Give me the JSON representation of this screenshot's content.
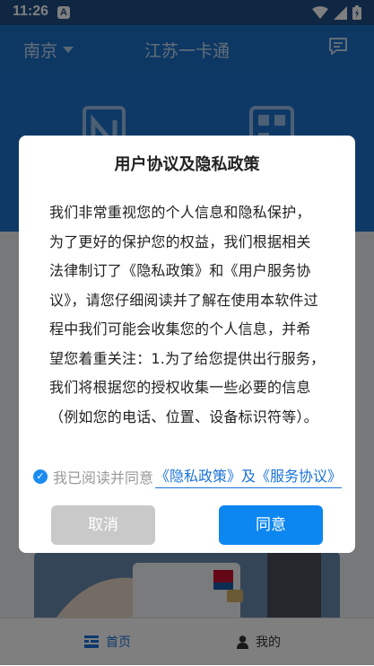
{
  "status_bar": {
    "time": "11:26",
    "notification_letter": "A"
  },
  "header": {
    "city": "南京",
    "title": "江苏一卡通"
  },
  "tab_bar": {
    "home_label": "首页",
    "mine_label": "我的"
  },
  "dialog": {
    "title": "用户协议及隐私政策",
    "body_lines": [
      "我们非常重视您的个人信息和隐私保护，",
      "为了更好的保护您的权益，我们根据相关",
      "法律制订了《隐私政策》和《用户服务协",
      "议》，请您仔细阅读并了解在使用本软件过",
      "程中我们可能会收集您的个人信息，并希",
      "望您着重关注：1.为了给您提供出行服务，",
      "我们将根据您的授权收集一些必要的信息",
      "（例如您的电话、位置、设备标识符等）。"
    ],
    "consent_text": "我已阅读并同意",
    "consent_link": "《隐私政策》及《服务协议》",
    "consent_checked": true,
    "cancel_label": "取消",
    "agree_label": "同意"
  },
  "colors": {
    "primary": "#0c86f0",
    "header_blue": "#1d72cc",
    "cancel_gray": "#c9c9c9",
    "link": "#1a73d9"
  }
}
